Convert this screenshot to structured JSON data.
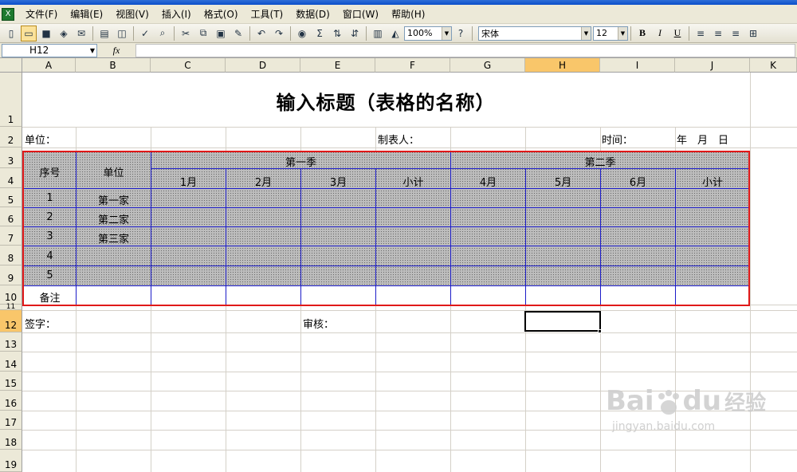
{
  "menu": [
    "文件(F)",
    "编辑(E)",
    "视图(V)",
    "插入(I)",
    "格式(O)",
    "工具(T)",
    "数据(D)",
    "窗口(W)",
    "帮助(H)"
  ],
  "toolbar": {
    "zoom": "100%",
    "font": "宋体",
    "font_size": "12",
    "bold": "B",
    "italic": "I",
    "underline": "U",
    "sigma": "Σ"
  },
  "namebox": "H12",
  "fx": "fx",
  "columns": [
    "A",
    "B",
    "C",
    "D",
    "E",
    "F",
    "G",
    "H",
    "I",
    "J",
    "K"
  ],
  "rows": [
    "1",
    "2",
    "3",
    "4",
    "5",
    "6",
    "7",
    "8",
    "9",
    "10",
    "11",
    "12",
    "13",
    "14",
    "15",
    "16",
    "17",
    "18",
    "19"
  ],
  "sheet": {
    "title": "输入标题（表格的名称）",
    "unit_label": "单位：",
    "maker_label": "制表人：",
    "time_label": "时间：",
    "date_label": "年　月　日",
    "col_seq": "序号",
    "col_unit": "单位",
    "q1": "第一季",
    "q2": "第二季",
    "months": [
      "1月",
      "2月",
      "3月",
      "小计",
      "4月",
      "5月",
      "6月",
      "小计"
    ],
    "seq": [
      "1",
      "2",
      "3",
      "4",
      "5"
    ],
    "units": [
      "第一家",
      "第二家",
      "第三家",
      "",
      ""
    ],
    "remark": "备注",
    "sign_label": "签字：",
    "review_label": "审核："
  },
  "watermark": {
    "brand": "Bai",
    "brand2": "du",
    "cn": "经验",
    "url": "jingyan.baidu.com"
  }
}
